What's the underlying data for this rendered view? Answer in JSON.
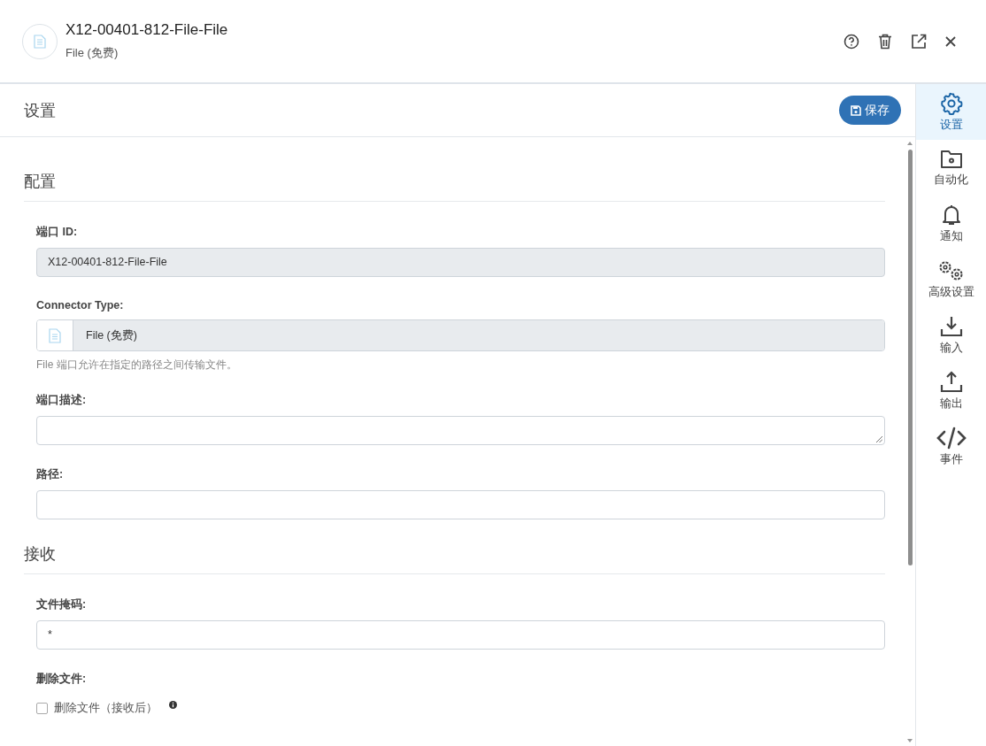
{
  "header": {
    "title": "X12-00401-812-File-File",
    "subtitle": "File (免费)"
  },
  "panel": {
    "title": "设置",
    "save_label": "保存"
  },
  "sections": [
    {
      "title": "配置",
      "fields": [
        {
          "kind": "readonly",
          "label": "端口 ID:",
          "value": "X12-00401-812-File-File"
        },
        {
          "kind": "type",
          "label": "Connector Type:",
          "value": "File (免费)",
          "hint": "File 端口允许在指定的路径之间传输文件。"
        },
        {
          "kind": "textarea",
          "label": "端口描述:"
        },
        {
          "kind": "text",
          "label": "路径:"
        }
      ]
    },
    {
      "title": "接收",
      "fields": [
        {
          "kind": "text",
          "label": "文件掩码:",
          "value": "*"
        },
        {
          "kind": "checkbox",
          "label": "删除文件:",
          "option": "删除文件（接收后）",
          "checked": false
        }
      ]
    }
  ],
  "nav": [
    {
      "label": "设置",
      "selected": true
    },
    {
      "label": "自动化",
      "selected": false
    },
    {
      "label": "通知",
      "selected": false
    },
    {
      "label": "高级设置",
      "selected": false
    },
    {
      "label": "输入",
      "selected": false
    },
    {
      "label": "输出",
      "selected": false
    },
    {
      "label": "事件",
      "selected": false
    }
  ]
}
